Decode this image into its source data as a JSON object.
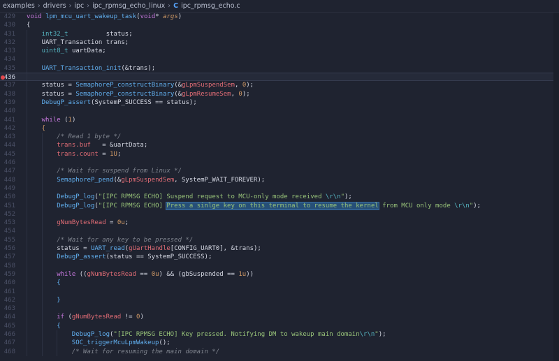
{
  "breadcrumb": {
    "parts": [
      "examples",
      "drivers",
      "ipc",
      "ipc_rpmsg_echo_linux"
    ],
    "file_icon": "C",
    "file": "ipc_rpmsg_echo.c"
  },
  "editor": {
    "breakpoint_line": 436,
    "active_line": 436,
    "lines": [
      {
        "n": 429,
        "indent": 0,
        "t": [
          [
            "kw",
            "void "
          ],
          [
            "fn",
            "lpm_mcu_uart_wakeup_task"
          ],
          [
            "",
            "("
          ],
          [
            "kw",
            "void"
          ],
          [
            "",
            "* "
          ],
          [
            "pr",
            "args"
          ],
          [
            "",
            ")"
          ]
        ]
      },
      {
        "n": 430,
        "indent": 0,
        "t": [
          [
            "",
            "{"
          ]
        ]
      },
      {
        "n": 431,
        "indent": 1,
        "t": [
          [
            "ty",
            "int32_t"
          ],
          [
            "",
            "          status;"
          ]
        ]
      },
      {
        "n": 432,
        "indent": 1,
        "t": [
          [
            "",
            "UART_Transaction trans;"
          ]
        ]
      },
      {
        "n": 433,
        "indent": 1,
        "t": [
          [
            "ty",
            "uint8_t"
          ],
          [
            "",
            " uartData;"
          ]
        ]
      },
      {
        "n": 434,
        "indent": 1,
        "t": []
      },
      {
        "n": 435,
        "indent": 1,
        "t": [
          [
            "fn",
            "UART_Transaction_init"
          ],
          [
            "",
            "(&trans);"
          ]
        ]
      },
      {
        "n": 436,
        "indent": 1,
        "t": []
      },
      {
        "n": 437,
        "indent": 1,
        "t": [
          [
            "",
            "status = "
          ],
          [
            "fn",
            "SemaphoreP_constructBinary"
          ],
          [
            "",
            "(&"
          ],
          [
            "gv",
            "gLpmSuspendSem"
          ],
          [
            "",
            ", "
          ],
          [
            "nm",
            "0"
          ],
          [
            "",
            ");"
          ]
        ]
      },
      {
        "n": 438,
        "indent": 1,
        "t": [
          [
            "",
            "status = "
          ],
          [
            "fn",
            "SemaphoreP_constructBinary"
          ],
          [
            "",
            "(&"
          ],
          [
            "gv",
            "gLpmResumeSem"
          ],
          [
            "",
            ", "
          ],
          [
            "nm",
            "0"
          ],
          [
            "",
            ");"
          ]
        ]
      },
      {
        "n": 439,
        "indent": 1,
        "t": [
          [
            "fn",
            "DebugP_assert"
          ],
          [
            "",
            "(SystemP_SUCCESS == status);"
          ]
        ]
      },
      {
        "n": 440,
        "indent": 1,
        "t": []
      },
      {
        "n": 441,
        "indent": 1,
        "t": [
          [
            "kw",
            "while"
          ],
          [
            "",
            " ("
          ],
          [
            "nm",
            "1"
          ],
          [
            "",
            ")"
          ]
        ]
      },
      {
        "n": 442,
        "indent": 1,
        "t": [
          [
            "nm",
            "{"
          ]
        ]
      },
      {
        "n": 443,
        "indent": 2,
        "t": [
          [
            "cm",
            "/* Read 1 byte */"
          ]
        ]
      },
      {
        "n": 444,
        "indent": 2,
        "t": [
          [
            "mb",
            "trans.buf"
          ],
          [
            "",
            "   = &uartData;"
          ]
        ]
      },
      {
        "n": 445,
        "indent": 2,
        "t": [
          [
            "mb",
            "trans.count"
          ],
          [
            "",
            " = "
          ],
          [
            "nm",
            "1U"
          ],
          [
            "",
            ";"
          ]
        ]
      },
      {
        "n": 446,
        "indent": 2,
        "t": []
      },
      {
        "n": 447,
        "indent": 2,
        "t": [
          [
            "cm",
            "/* Wait for suspend from Linux */"
          ]
        ]
      },
      {
        "n": 448,
        "indent": 2,
        "t": [
          [
            "fn",
            "SemaphoreP_pend"
          ],
          [
            "",
            "(&"
          ],
          [
            "gv",
            "gLpmSuspendSem"
          ],
          [
            "",
            ", SystemP_WAIT_FOREVER);"
          ]
        ]
      },
      {
        "n": 449,
        "indent": 2,
        "t": []
      },
      {
        "n": 450,
        "indent": 2,
        "t": [
          [
            "fn",
            "DebugP_log"
          ],
          [
            "",
            "("
          ],
          [
            "st",
            "\"[IPC RPMSG ECHO] Suspend request to MCU-only mode received "
          ],
          [
            "es",
            "\\r\\n"
          ],
          [
            "st",
            "\""
          ],
          [
            "",
            ");"
          ]
        ]
      },
      {
        "n": 451,
        "indent": 2,
        "t": [
          [
            "fn",
            "DebugP_log"
          ],
          [
            "",
            "("
          ],
          [
            "st",
            "\"[IPC RPMSG ECHO] "
          ],
          [
            "st sel",
            "Press a sinlge key on this terminal to resume the kernel"
          ],
          [
            "st",
            " from MCU only mode "
          ],
          [
            "es",
            "\\r\\n"
          ],
          [
            "st",
            "\""
          ],
          [
            "",
            ");"
          ]
        ]
      },
      {
        "n": 452,
        "indent": 2,
        "t": []
      },
      {
        "n": 453,
        "indent": 2,
        "t": [
          [
            "gv",
            "gNumBytesRead"
          ],
          [
            "",
            " = "
          ],
          [
            "nm",
            "0u"
          ],
          [
            "",
            ";"
          ]
        ]
      },
      {
        "n": 454,
        "indent": 2,
        "t": []
      },
      {
        "n": 455,
        "indent": 2,
        "t": [
          [
            "cm",
            "/* Wait for any key to be pressed */"
          ]
        ]
      },
      {
        "n": 456,
        "indent": 2,
        "t": [
          [
            "",
            "status = "
          ],
          [
            "fn",
            "UART_read"
          ],
          [
            "",
            "("
          ],
          [
            "gv",
            "gUartHandle"
          ],
          [
            "",
            "[CONFIG_UART0], &trans);"
          ]
        ]
      },
      {
        "n": 457,
        "indent": 2,
        "t": [
          [
            "fn",
            "DebugP_assert"
          ],
          [
            "",
            "(status == SystemP_SUCCESS);"
          ]
        ]
      },
      {
        "n": 458,
        "indent": 2,
        "t": []
      },
      {
        "n": 459,
        "indent": 2,
        "t": [
          [
            "kw",
            "while"
          ],
          [
            "",
            " (("
          ],
          [
            "gv",
            "gNumBytesRead"
          ],
          [
            "",
            " == "
          ],
          [
            "nm",
            "0u"
          ],
          [
            "",
            ") && ("
          ],
          [
            "cn",
            "gbSuspended"
          ],
          [
            "",
            " == "
          ],
          [
            "nm",
            "1u"
          ],
          [
            "",
            "))"
          ]
        ]
      },
      {
        "n": 460,
        "indent": 2,
        "t": [
          [
            "fn",
            "{"
          ]
        ]
      },
      {
        "n": 461,
        "indent": 2,
        "t": []
      },
      {
        "n": 462,
        "indent": 2,
        "t": [
          [
            "fn",
            "}"
          ]
        ]
      },
      {
        "n": 463,
        "indent": 2,
        "t": []
      },
      {
        "n": 464,
        "indent": 2,
        "t": [
          [
            "kw",
            "if"
          ],
          [
            "",
            " ("
          ],
          [
            "gv",
            "gNumBytesRead"
          ],
          [
            "",
            " != "
          ],
          [
            "nm",
            "0"
          ],
          [
            "",
            ")"
          ]
        ]
      },
      {
        "n": 465,
        "indent": 2,
        "t": [
          [
            "fn",
            "{"
          ]
        ]
      },
      {
        "n": 466,
        "indent": 3,
        "t": [
          [
            "fn",
            "DebugP_log"
          ],
          [
            "",
            "("
          ],
          [
            "st",
            "\"[IPC RPMSG ECHO] Key pressed. Notifying DM to wakeup main domain"
          ],
          [
            "es",
            "\\r\\n"
          ],
          [
            "st",
            "\""
          ],
          [
            "",
            ");"
          ]
        ]
      },
      {
        "n": 467,
        "indent": 3,
        "t": [
          [
            "fn",
            "SOC_triggerMcuLpmWakeup"
          ],
          [
            "",
            "();"
          ]
        ]
      },
      {
        "n": 468,
        "indent": 3,
        "t": [
          [
            "cm",
            "/* Wait for resuming the main domain */"
          ]
        ]
      }
    ]
  }
}
